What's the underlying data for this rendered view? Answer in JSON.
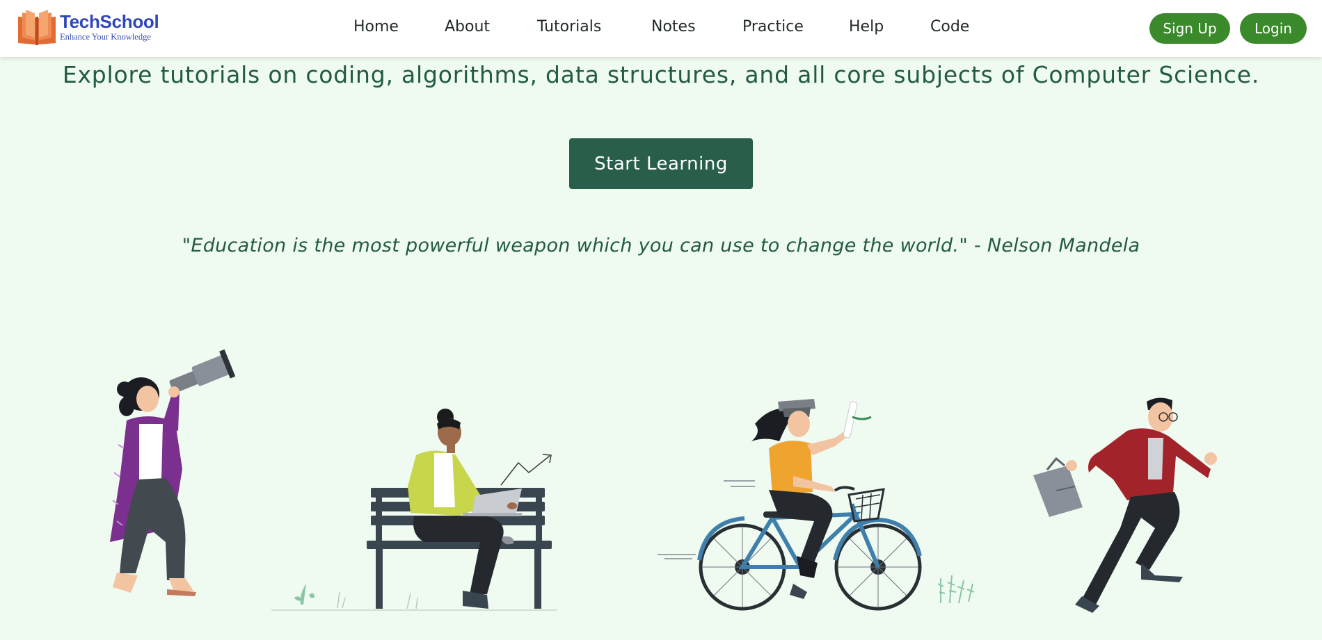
{
  "brand": {
    "name": "TechSchool",
    "tagline": "Enhance Your Knowledge",
    "logo_icon": "open-book-icon",
    "colors": {
      "logo": "#e26b34",
      "name": "#2f47b8",
      "accent_button": "#3a8a2c",
      "cta": "#285e4a",
      "text": "#225a45",
      "background": "#effaf1"
    }
  },
  "nav": {
    "links": [
      {
        "label": "Home"
      },
      {
        "label": "About"
      },
      {
        "label": "Tutorials"
      },
      {
        "label": "Notes"
      },
      {
        "label": "Practice"
      },
      {
        "label": "Help"
      },
      {
        "label": "Code"
      }
    ],
    "signup_label": "Sign Up",
    "login_label": "Login"
  },
  "hero": {
    "subtitle": "Explore tutorials on coding, algorithms, data structures, and all core subjects of Computer Science.",
    "cta_label": "Start Learning",
    "quote": "\"Education is the most powerful weapon which you can use to change the world.\" - Nelson Mandela"
  },
  "illustrations": [
    {
      "name": "woman-with-telescope-illustration"
    },
    {
      "name": "man-on-bench-with-laptop-illustration"
    },
    {
      "name": "graduate-on-bicycle-illustration"
    },
    {
      "name": "running-businessman-illustration"
    }
  ]
}
